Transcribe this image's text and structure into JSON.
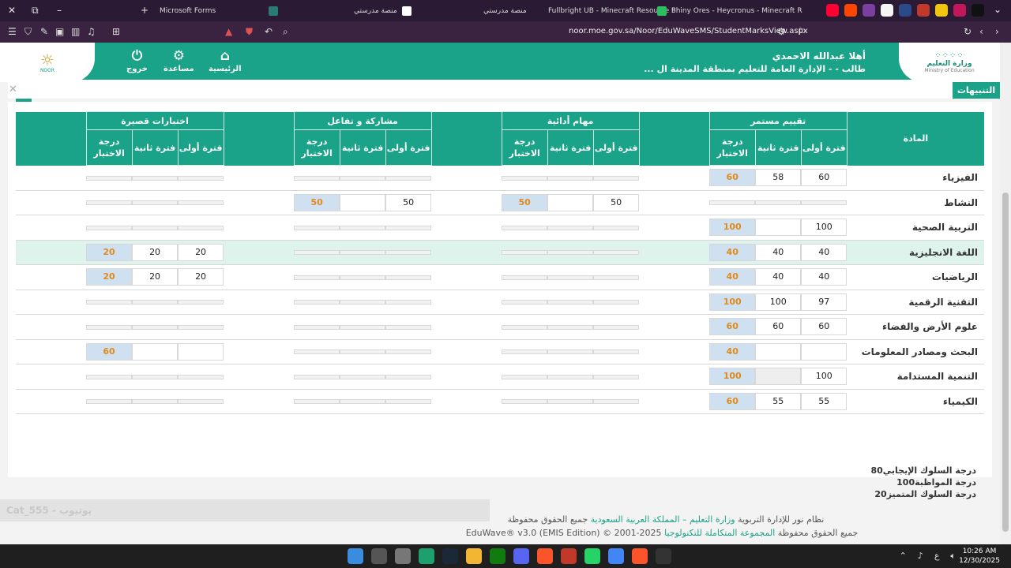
{
  "browser": {
    "tabs": [
      {
        "title": "Microsoft Forms",
        "color": "#2b7a78"
      },
      {
        "title": "منصة مدرستي",
        "color": "#ffffff"
      },
      {
        "title": "منصة مدرستي",
        "color": "#ffffff"
      },
      {
        "title": "Fullbright UB - Minecraft Resource P",
        "color": "#3a2340"
      },
      {
        "title": "Shiny Ores - Heycronus - Minecraft R",
        "color": "#2dbe60"
      }
    ],
    "url": "noor.moe.gov.sa/Noor/EduWaveSMS/StudentMarksView.aspx",
    "nav_icons": [
      "close-icon",
      "restore-icon",
      "minimize-icon",
      "new-tab-icon"
    ]
  },
  "header": {
    "moe_logo_dots": "⁘⁘⁘⁘",
    "moe_logo_title": "وزارة التعليم",
    "moe_logo_sub": "Ministry of Education",
    "noor_logo_text": "NOOR",
    "greeting": "أهلا عبدالله الاحمدي",
    "user_line": "طالب - - الإدارة العامة للتعليم بمنطقة المدينة ال ...",
    "nav": {
      "home": "الرئيسية",
      "help": "مساعدة",
      "logout": "خروج"
    }
  },
  "alerts": {
    "label": "التنبيهات"
  },
  "table": {
    "subject_header": "المادة",
    "groups": [
      "تقييم مستمر",
      "مهام أدائية",
      "مشاركة و تفاعل",
      "اختبارات قصيرة"
    ],
    "sub_headers": [
      "فترة أولى",
      "فترة ثانية",
      "درجة الاختبار"
    ],
    "rows": [
      {
        "subject": "الفيزياء",
        "g1": [
          "60",
          "58",
          "60"
        ],
        "g2": null,
        "g3": null,
        "g4": null
      },
      {
        "subject": "النشاط",
        "g1": null,
        "g2": [
          "50",
          "",
          "50"
        ],
        "g3": [
          "50",
          "",
          "50"
        ],
        "g4": null
      },
      {
        "subject": "التربية الصحية",
        "g1": [
          "100",
          "",
          "100"
        ],
        "g2": null,
        "g3": null,
        "g4": null
      },
      {
        "subject": "اللغة الانجليزية",
        "g1": [
          "40",
          "40",
          "40"
        ],
        "g2": null,
        "g3": null,
        "g4": [
          "20",
          "20",
          "20"
        ],
        "highlight": true
      },
      {
        "subject": "الرياضيات",
        "g1": [
          "40",
          "40",
          "40"
        ],
        "g2": null,
        "g3": null,
        "g4": [
          "20",
          "20",
          "20"
        ]
      },
      {
        "subject": "التقنية الرقمية",
        "g1": [
          "97",
          "100",
          "100"
        ],
        "g2": null,
        "g3": null,
        "g4": null
      },
      {
        "subject": "علوم الأرض والفضاء",
        "g1": [
          "60",
          "60",
          "60"
        ],
        "g2": null,
        "g3": null,
        "g4": null
      },
      {
        "subject": "البحث ومصادر المعلومات",
        "g1": [
          "",
          "",
          "40"
        ],
        "g2": null,
        "g3": null,
        "g4": [
          "",
          "",
          "60"
        ]
      },
      {
        "subject": "التنمية المستدامة",
        "g1": [
          "100",
          "",
          "100"
        ],
        "g2": null,
        "g3": null,
        "g4": null
      },
      {
        "subject": "الكيمياء",
        "g1": [
          "55",
          "55",
          "60"
        ],
        "g2": null,
        "g3": null,
        "g4": null
      }
    ]
  },
  "behavior": {
    "positive": "درجة السلوك الإيجابي80",
    "attendance": "درجة المواظبة100",
    "excellent": "درجة السلوك المتميز20"
  },
  "footer": {
    "blurred": "Cat_555 - يوتيوب",
    "line1_a": "نظام نور للإدارة التربوية",
    "line1_b": "وزارة التعليم – المملكة العربية السعودية",
    "line1_c": "جميع الحقوق محفوظة",
    "line2_a": "جميع الحقوق محفوظة",
    "line2_b": "المجموعة المتكاملة للتكنولوجيا",
    "line2_c": "EduWave® v3.0 (EMIS Edition) © 2001-2025"
  },
  "taskbar": {
    "time": "10:26 AM",
    "date": "12/30/2025",
    "lang": "ع"
  }
}
